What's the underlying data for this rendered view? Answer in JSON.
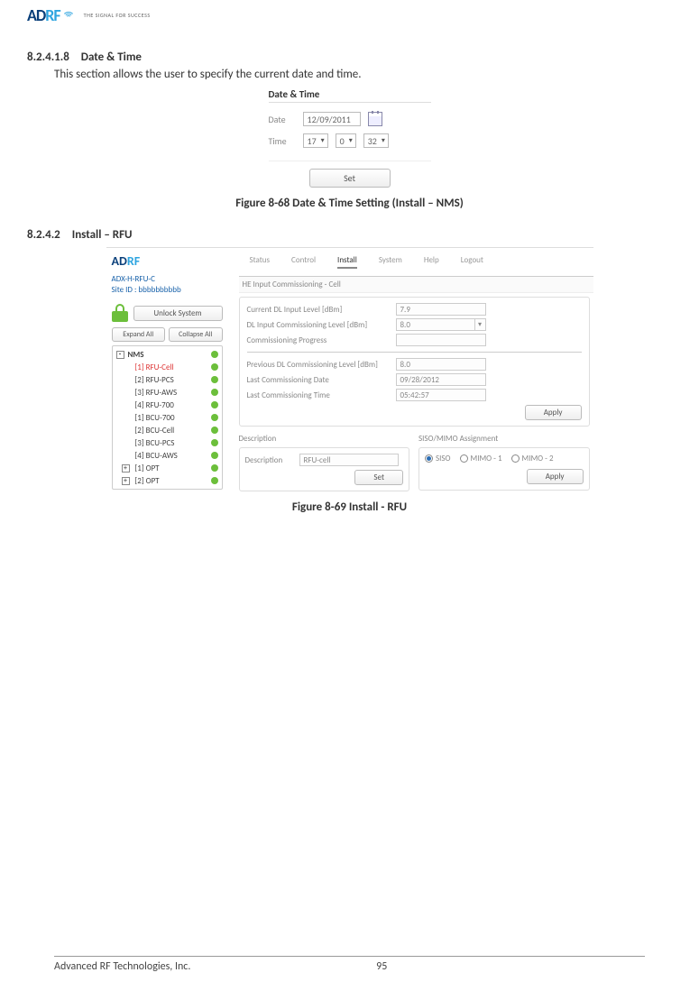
{
  "header": {
    "logo_left": "AD",
    "logo_right": "RF",
    "tagline": "THE SIGNAL FOR SUCCESS"
  },
  "sections": {
    "s1_num": "8.2.4.1.8",
    "s1_title": "Date & Time",
    "s1_body": "This section allows the user to specify the current date and time.",
    "s2_num": "8.2.4.2",
    "s2_title": "Install – RFU"
  },
  "fig68": {
    "title": "Date & Time",
    "date_label": "Date",
    "date_value": "12/09/2011",
    "time_label": "Time",
    "hh": "17",
    "mm": "0",
    "ss": "32",
    "set_btn": "Set",
    "caption": "Figure 8-68   Date & Time Setting (Install – NMS)"
  },
  "fig69": {
    "caption": "Figure 8-69   Install - RFU",
    "logo_left": "AD",
    "logo_right": "RF",
    "device_line1": "ADX-H-RFU-C",
    "device_line2": "Site ID : bbbbbbbbbb",
    "unlock_btn": "Unlock System",
    "expand_btn": "Expand All",
    "collapse_btn": "Collapse All",
    "tabs": [
      "Status",
      "Control",
      "Install",
      "System",
      "Help",
      "Logout"
    ],
    "active_tab": 2,
    "tree": [
      {
        "sign": "-",
        "label": "NMS",
        "sel": false,
        "nms": true
      },
      {
        "sign": "",
        "label": "[1] RFU-Cell",
        "sel": true
      },
      {
        "sign": "",
        "label": "[2] RFU-PCS",
        "sel": false
      },
      {
        "sign": "",
        "label": "[3] RFU-AWS",
        "sel": false
      },
      {
        "sign": "",
        "label": "[4] RFU-700",
        "sel": false
      },
      {
        "sign": "",
        "label": "[1] BCU-700",
        "sel": false
      },
      {
        "sign": "",
        "label": "[2] BCU-Cell",
        "sel": false
      },
      {
        "sign": "",
        "label": "[3] BCU-PCS",
        "sel": false
      },
      {
        "sign": "",
        "label": "[4] BCU-AWS",
        "sel": false
      },
      {
        "sign": "+",
        "label": "[1] OPT",
        "sel": false
      },
      {
        "sign": "+",
        "label": "[2] OPT",
        "sel": false
      }
    ],
    "he_title": "HE Input Commissioning - Cell",
    "fields_top": [
      {
        "label": "Current DL Input Level [dBm]",
        "value": "7.9",
        "dd": false
      },
      {
        "label": "DL Input Commissioning Level [dBm]",
        "value": "8.0",
        "dd": true
      },
      {
        "label": "Commissioning Progress",
        "value": "",
        "dd": false
      }
    ],
    "fields_bottom": [
      {
        "label": "Previous DL Commissioning Level [dBm]",
        "value": "8.0"
      },
      {
        "label": "Last Commissioning Date",
        "value": "09/28/2012"
      },
      {
        "label": "Last Commissioning Time",
        "value": "05:42:57"
      }
    ],
    "apply_btn": "Apply",
    "desc_title": "Description",
    "desc_label": "Description",
    "desc_value": "RFU-cell",
    "desc_set": "Set",
    "assign_title": "SISO/MIMO Assignment",
    "assign_opts": [
      "SISO",
      "MIMO - 1",
      "MIMO - 2"
    ],
    "assign_sel": 0,
    "assign_apply": "Apply"
  },
  "footer": {
    "company": "Advanced RF Technologies, Inc.",
    "page": "95"
  }
}
